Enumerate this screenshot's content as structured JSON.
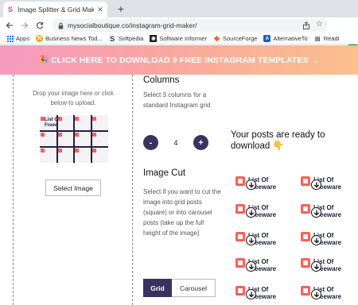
{
  "browser": {
    "tab_title": "Image Splitter & Grid Maker for I",
    "tab_favicon": "S",
    "url": "mysocialboutique.co/instagram-grid-maker/",
    "profile_initial": "R",
    "bookmarks": [
      {
        "label": "Apps",
        "icon": "apps-grid-icon"
      },
      {
        "label": "Business News Tod...",
        "icon": "news-icon"
      },
      {
        "label": "Softpedia",
        "icon": "softpedia-icon"
      },
      {
        "label": "Software Informer",
        "icon": "software-informer-icon"
      },
      {
        "label": "SourceForge",
        "icon": "sourceforge-icon"
      },
      {
        "label": "AlternativeTo",
        "icon": "alternativeto-icon"
      },
      {
        "label": "Readi",
        "icon": "reading-list-icon"
      }
    ]
  },
  "banner": {
    "text": "CLICK HERE TO DOWNLOAD 9 FREE INSTAGRAM TEMPLATES →",
    "icon": "🎉"
  },
  "upload": {
    "drop_text": "Drop your image here or click below to upload.",
    "preview_label": "List Of Freeware",
    "button_label": "Select Image"
  },
  "columns": {
    "heading": "Columns",
    "description": "Select 3 columns for a standard Instagram grid",
    "value": "4",
    "minus_label": "-",
    "plus_label": "+"
  },
  "image_cut": {
    "heading": "Image Cut",
    "description": "Select if you want to cut the image into grid posts (square) or into carousel posts (take up the full height of the image)",
    "options": [
      "Grid",
      "Carousel"
    ],
    "selected": "Grid"
  },
  "results": {
    "heading": "Your posts are ready to download",
    "heading_emoji": "👇",
    "tile_label_line1": "List Of",
    "tile_label_line2": "Freeware"
  },
  "colors": {
    "accent": "#3a3360",
    "banner_start": "#f79ac0",
    "banner_end": "#fbc08c",
    "brand_red": "#ff5e57"
  }
}
